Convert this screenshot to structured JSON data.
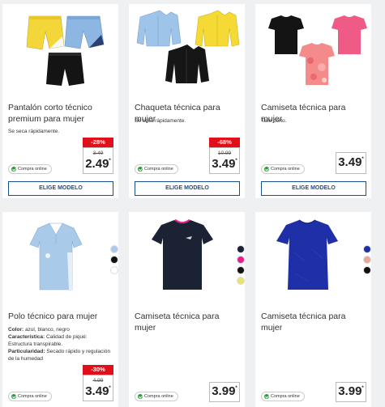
{
  "products": [
    {
      "title": "Pantalón corto técnico premium para mujer",
      "subtitle": "Se seca rápidamente.",
      "discount": "-28%",
      "old_price": "3.49",
      "price": "2.49",
      "price_mark": "*",
      "badge": "Compra online",
      "button": "ELIGE MODELO"
    },
    {
      "title": "Chaqueta técnica para mujer",
      "subtitle": "Se seca rápidamente.",
      "discount": "-68%",
      "old_price": "10.99",
      "price": "3.49",
      "price_mark": "*",
      "badge": "Compra online",
      "button": "ELIGE MODELO"
    },
    {
      "title": "Camiseta técnica para mujer",
      "subtitle": "Talle corto.",
      "price": "3.49",
      "price_mark": "*",
      "badge": "Compra online",
      "button": "ELIGE MODELO"
    },
    {
      "title": "Polo técnico para mujer",
      "attributes": [
        {
          "label": "Color:",
          "value": " azul, blanco, negro"
        },
        {
          "label": "Característica:",
          "value": " Calidad de piqué: Estructura transpirable."
        },
        {
          "label": "Particularidad:",
          "value": " Secado rápido y regulación de la humedad"
        }
      ],
      "discount": "-30%",
      "old_price": "4.99",
      "price": "3.49",
      "price_mark": "*",
      "badge": "Compra online",
      "swatches": [
        "#a9cbe9",
        "#111111",
        "#ffffff"
      ]
    },
    {
      "title": "Camiseta técnica para mujer",
      "price": "3.99",
      "price_mark": "*",
      "badge": "Compra online",
      "swatches": [
        "#1a2233",
        "#e81c8c",
        "#111111",
        "#e9e36b"
      ]
    },
    {
      "title": "Camiseta técnica para mujer",
      "price": "3.99",
      "price_mark": "*",
      "badge": "Compra online",
      "swatches": [
        "#1f2fa8",
        "#e9a79b",
        "#111111"
      ]
    }
  ],
  "colors": {
    "accent_blue": "#1a4d8f",
    "discount_red": "#e0101b",
    "online_green": "#2a9d3a"
  }
}
